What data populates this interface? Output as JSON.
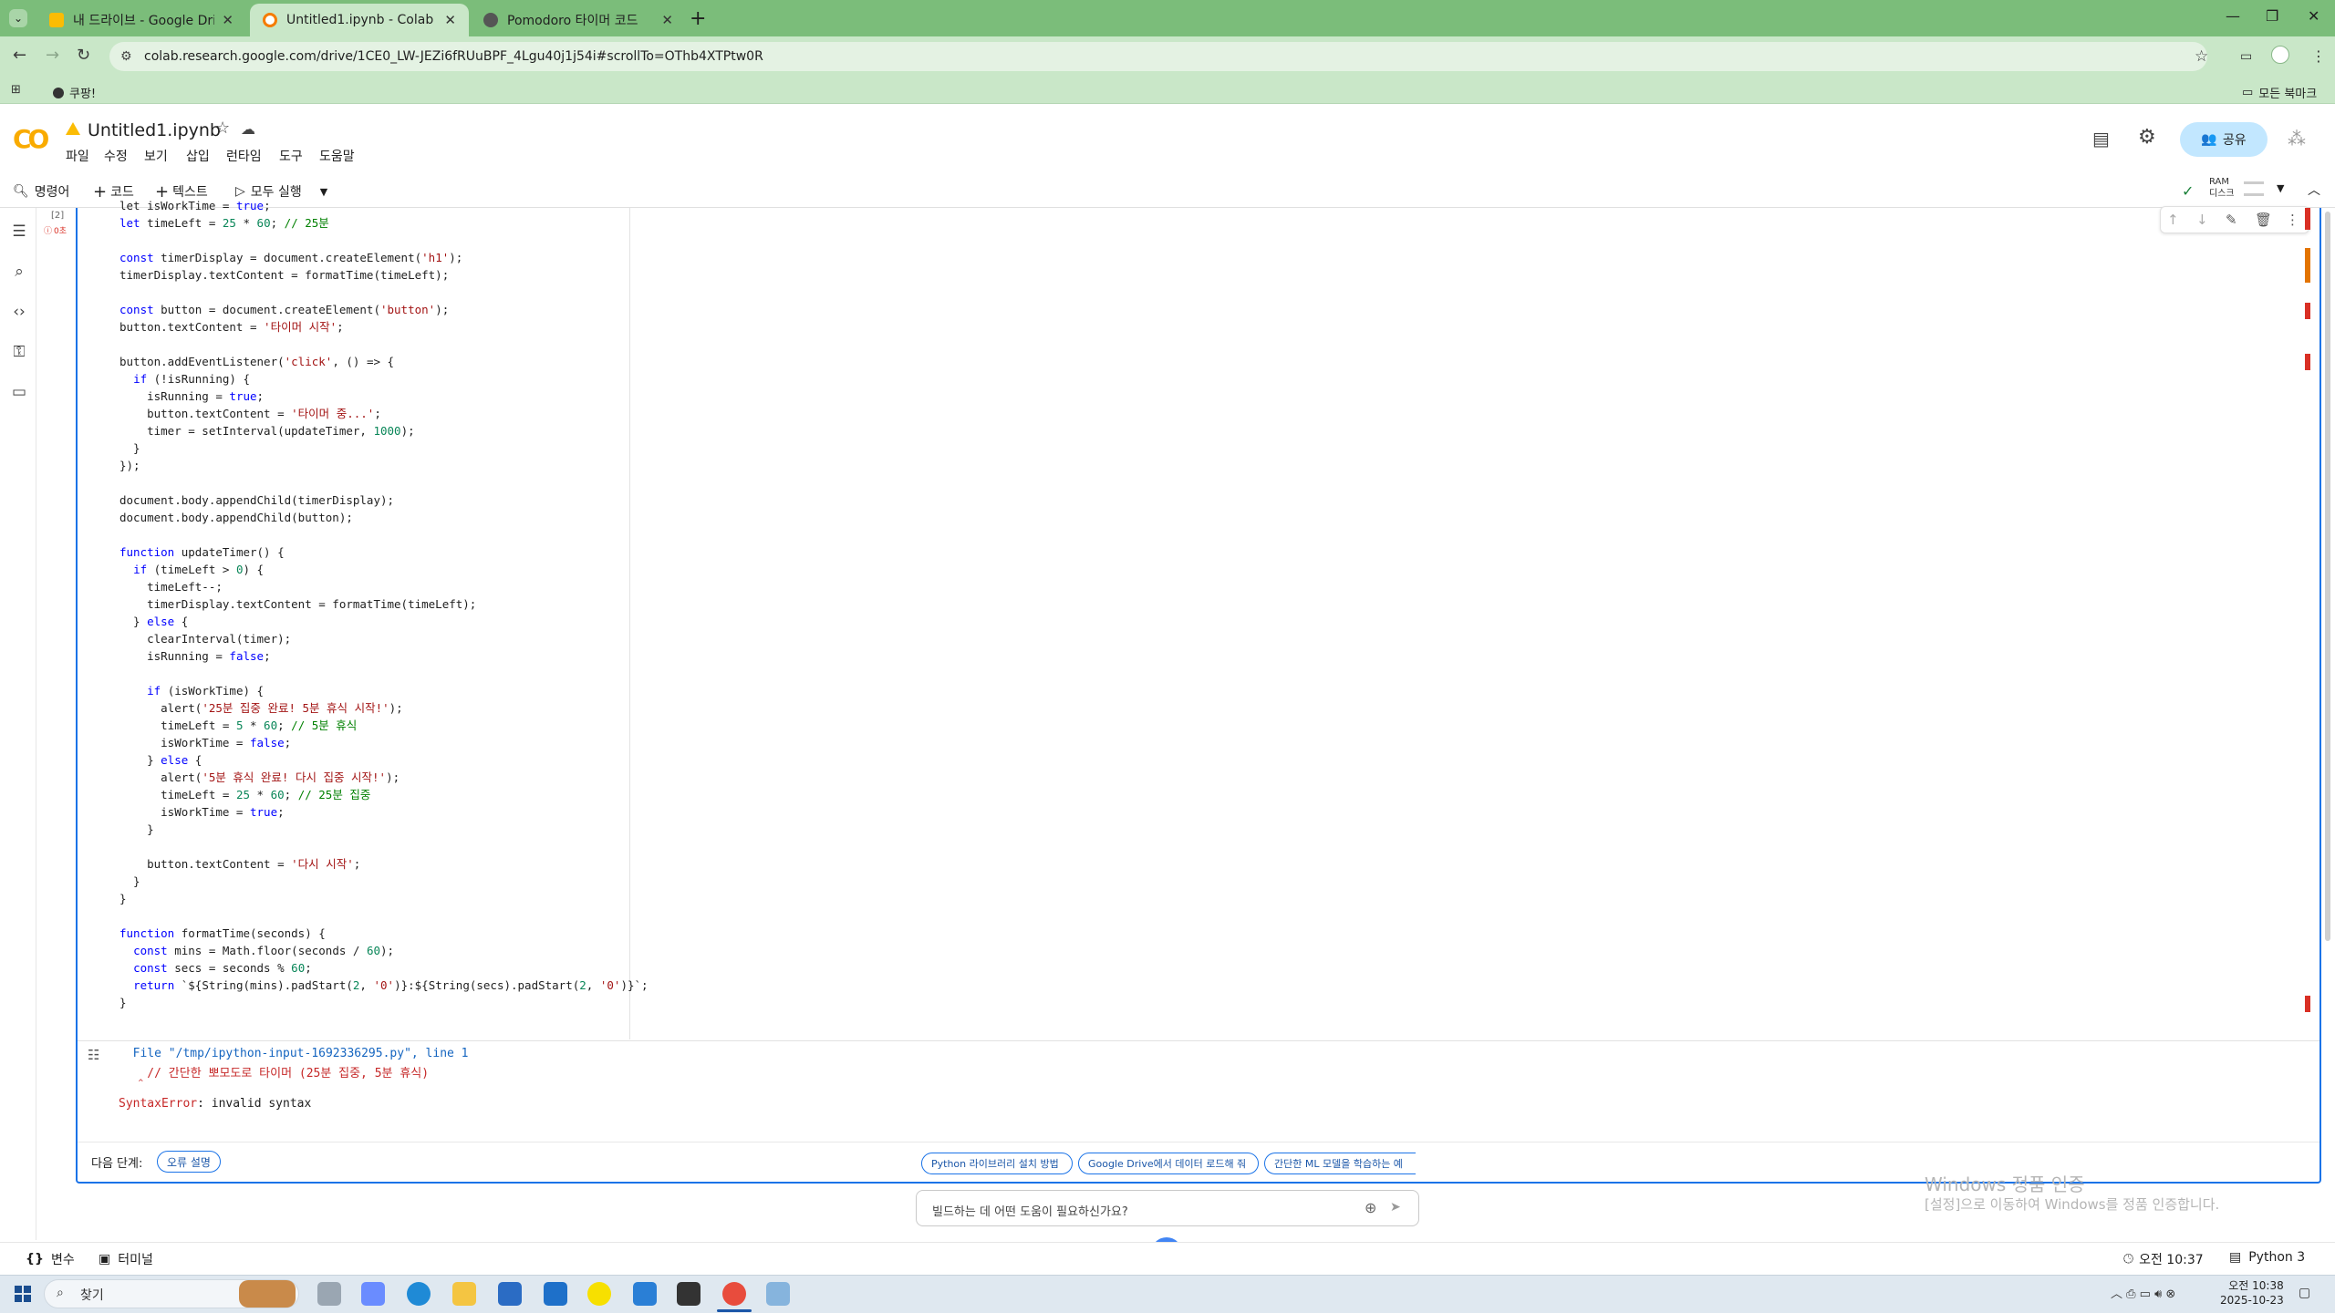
{
  "browser": {
    "tabs": [
      {
        "title": "내 드라이브 - Google Drive",
        "color": "#fbbc04"
      },
      {
        "title": "Untitled1.ipynb - Colab",
        "color": "#f57c00"
      },
      {
        "title": "Pomodoro 타이머 코드",
        "color": "#555555"
      }
    ],
    "url": "colab.research.google.com/drive/1CE0_LW-JEZi6fRUuBPF_4Lgu40j1j54i#scrollTo=OThb4XTPtw0R",
    "bookmark": "쿠팡!",
    "all_bookmarks": "모든 북마크"
  },
  "colab": {
    "logo": "CO",
    "title": "Untitled1.ipynb",
    "menu": [
      "파일",
      "수정",
      "보기",
      "삽입",
      "런타임",
      "도구",
      "도움말"
    ],
    "share": "공유",
    "toolbar": {
      "command": "명령어",
      "code": "코드",
      "text": "텍스트",
      "run_all": "모두 실행",
      "ram": "RAM",
      "disk": "디스크"
    },
    "cell_exec": "[2]",
    "cell_err": "0초",
    "code_lines": [
      [
        [
          "let ",
          ""
        ],
        [
          "isWorkTime",
          ""
        ],
        [
          " = ",
          ""
        ],
        [
          "true",
          "kw"
        ],
        [
          ";",
          ""
        ]
      ],
      [
        [
          "let ",
          "kw"
        ],
        [
          "timeLeft",
          ""
        ],
        [
          " = ",
          ""
        ],
        [
          "25",
          "num"
        ],
        [
          " * ",
          ""
        ],
        [
          "60",
          "num"
        ],
        [
          "; ",
          ""
        ],
        [
          "// 25분",
          "cm"
        ]
      ],
      [
        [
          "",
          ""
        ]
      ],
      [
        [
          "const ",
          "kw"
        ],
        [
          "timerDisplay = document.createElement(",
          ""
        ],
        [
          "'h1'",
          "str"
        ],
        [
          ");",
          ""
        ]
      ],
      [
        [
          "timerDisplay.textContent = formatTime(timeLeft);",
          ""
        ]
      ],
      [
        [
          "",
          ""
        ]
      ],
      [
        [
          "const ",
          "kw"
        ],
        [
          "button = document.createElement(",
          ""
        ],
        [
          "'button'",
          "str"
        ],
        [
          ");",
          ""
        ]
      ],
      [
        [
          "button.textContent = ",
          ""
        ],
        [
          "'타이머 시작'",
          "str"
        ],
        [
          ";",
          ""
        ]
      ],
      [
        [
          "",
          ""
        ]
      ],
      [
        [
          "button.addEventListener(",
          ""
        ],
        [
          "'click'",
          "str"
        ],
        [
          ", () => {",
          ""
        ]
      ],
      [
        [
          "  ",
          ""
        ],
        [
          "if",
          "kw"
        ],
        [
          " (!isRunning) {",
          ""
        ]
      ],
      [
        [
          "    isRunning = ",
          ""
        ],
        [
          "true",
          "kw"
        ],
        [
          ";",
          ""
        ]
      ],
      [
        [
          "    button.textContent = ",
          ""
        ],
        [
          "'타이머 중...'",
          "str"
        ],
        [
          ";",
          ""
        ]
      ],
      [
        [
          "    timer = setInterval(updateTimer, ",
          ""
        ],
        [
          "1000",
          "num"
        ],
        [
          ");",
          ""
        ]
      ],
      [
        [
          "  }",
          ""
        ]
      ],
      [
        [
          "});",
          ""
        ]
      ],
      [
        [
          "",
          ""
        ]
      ],
      [
        [
          "document.body.appendChild(timerDisplay);",
          ""
        ]
      ],
      [
        [
          "document.body.appendChild(button);",
          ""
        ]
      ],
      [
        [
          "",
          ""
        ]
      ],
      [
        [
          "function",
          "kw"
        ],
        [
          " updateTimer() {",
          ""
        ]
      ],
      [
        [
          "  ",
          ""
        ],
        [
          "if",
          "kw"
        ],
        [
          " (timeLeft > ",
          ""
        ],
        [
          "0",
          "num"
        ],
        [
          ") {",
          ""
        ]
      ],
      [
        [
          "    timeLeft--;",
          ""
        ]
      ],
      [
        [
          "    timerDisplay.textContent = formatTime(timeLeft);",
          ""
        ]
      ],
      [
        [
          "  } ",
          ""
        ],
        [
          "else",
          "kw"
        ],
        [
          " {",
          ""
        ]
      ],
      [
        [
          "    clearInterval(timer);",
          ""
        ]
      ],
      [
        [
          "    isRunning = ",
          ""
        ],
        [
          "false",
          "kw"
        ],
        [
          ";",
          ""
        ]
      ],
      [
        [
          "",
          ""
        ]
      ],
      [
        [
          "    ",
          ""
        ],
        [
          "if",
          "kw"
        ],
        [
          " (isWorkTime) {",
          ""
        ]
      ],
      [
        [
          "      alert(",
          ""
        ],
        [
          "'25분 집중 완료! 5분 휴식 시작!'",
          "str"
        ],
        [
          ");",
          ""
        ]
      ],
      [
        [
          "      timeLeft = ",
          ""
        ],
        [
          "5",
          "num"
        ],
        [
          " * ",
          ""
        ],
        [
          "60",
          "num"
        ],
        [
          "; ",
          ""
        ],
        [
          "// 5분 휴식",
          "cm"
        ]
      ],
      [
        [
          "      isWorkTime = ",
          ""
        ],
        [
          "false",
          "kw"
        ],
        [
          ";",
          ""
        ]
      ],
      [
        [
          "    } ",
          ""
        ],
        [
          "else",
          "kw"
        ],
        [
          " {",
          ""
        ]
      ],
      [
        [
          "      alert(",
          ""
        ],
        [
          "'5분 휴식 완료! 다시 집중 시작!'",
          "str"
        ],
        [
          ");",
          ""
        ]
      ],
      [
        [
          "      timeLeft = ",
          ""
        ],
        [
          "25",
          "num"
        ],
        [
          " * ",
          ""
        ],
        [
          "60",
          "num"
        ],
        [
          "; ",
          ""
        ],
        [
          "// 25분 집중",
          "cm"
        ]
      ],
      [
        [
          "      isWorkTime = ",
          ""
        ],
        [
          "true",
          "kw"
        ],
        [
          ";",
          ""
        ]
      ],
      [
        [
          "    }",
          ""
        ]
      ],
      [
        [
          "",
          ""
        ]
      ],
      [
        [
          "    button.textContent = ",
          ""
        ],
        [
          "'다시 시작'",
          "str"
        ],
        [
          ";",
          ""
        ]
      ],
      [
        [
          "  }",
          ""
        ]
      ],
      [
        [
          "}",
          ""
        ]
      ],
      [
        [
          "",
          ""
        ]
      ],
      [
        [
          "function",
          "kw"
        ],
        [
          " formatTime(seconds) {",
          ""
        ]
      ],
      [
        [
          "  ",
          ""
        ],
        [
          "const",
          "kw"
        ],
        [
          " mins = Math.floor(seconds / ",
          ""
        ],
        [
          "60",
          "num"
        ],
        [
          ");",
          ""
        ]
      ],
      [
        [
          "  ",
          ""
        ],
        [
          "const",
          "kw"
        ],
        [
          " secs = seconds % ",
          ""
        ],
        [
          "60",
          "num"
        ],
        [
          ";",
          ""
        ]
      ],
      [
        [
          "  ",
          ""
        ],
        [
          "return",
          "kw"
        ],
        [
          " `${String(mins).padStart(",
          ""
        ],
        [
          "2",
          "num"
        ],
        [
          ", ",
          ""
        ],
        [
          "'0'",
          "str"
        ],
        [
          ")}:${String(secs).padStart(",
          ""
        ],
        [
          "2",
          "num"
        ],
        [
          ", ",
          ""
        ],
        [
          "'0'",
          "str"
        ],
        [
          ")}`;",
          ""
        ]
      ],
      [
        [
          "}",
          ""
        ]
      ]
    ],
    "output": {
      "file_line": "  File \"/tmp/ipython-input-1692336295.py\", line 1",
      "source_line": "    // 간단한 뽀모도로 타이머 (25분 집중, 5분 휴식)",
      "caret": "    ^",
      "error_type": "SyntaxError",
      "error_msg": ": invalid syntax"
    },
    "next_steps_label": "다음 단계:",
    "explain_error": "오류 설명",
    "suggestions": [
      "Python 라이브러리 설치 방법",
      "Google Drive에서 데이터 로드해 줘",
      "간단한 ML 모델을 학습하는 예"
    ],
    "gemini_placeholder": "빌드하는 데 어떤 도움이 필요하신가요?",
    "status": {
      "variables": "변수",
      "terminal": "터미널",
      "time": "오전 10:37",
      "runtime": "Python 3"
    }
  },
  "watermark": {
    "line1": "Windows 정품 인증",
    "line2": "[설정]으로 이동하여 Windows를 정품 인증합니다."
  },
  "taskbar": {
    "search": "찾기",
    "clock_time": "오전 10:38",
    "clock_date": "2025-10-23"
  }
}
